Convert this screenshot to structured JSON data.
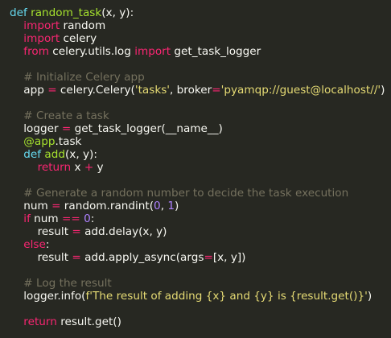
{
  "colors": {
    "background": "#272822",
    "plain": "#f8f8f2",
    "keyword": "#f92672",
    "def_keyword": "#66d9ef",
    "function_name": "#a6e22e",
    "string": "#e6db74",
    "number": "#ae81ff",
    "comment": "#75715e"
  },
  "code": {
    "lines": [
      [
        {
          "t": "def",
          "c": "def"
        },
        {
          "t": " ",
          "c": "plain"
        },
        {
          "t": "random_task",
          "c": "fn"
        },
        {
          "t": "(x, y):",
          "c": "plain"
        }
      ],
      [
        {
          "t": "    ",
          "c": "plain"
        },
        {
          "t": "import",
          "c": "kw"
        },
        {
          "t": " random",
          "c": "plain"
        }
      ],
      [
        {
          "t": "    ",
          "c": "plain"
        },
        {
          "t": "import",
          "c": "kw"
        },
        {
          "t": " celery",
          "c": "plain"
        }
      ],
      [
        {
          "t": "    ",
          "c": "plain"
        },
        {
          "t": "from",
          "c": "kw"
        },
        {
          "t": " celery.utils.log ",
          "c": "plain"
        },
        {
          "t": "import",
          "c": "kw"
        },
        {
          "t": " get_task_logger",
          "c": "plain"
        }
      ],
      [],
      [
        {
          "t": "    ",
          "c": "plain"
        },
        {
          "t": "# Initialize Celery app",
          "c": "cmt"
        }
      ],
      [
        {
          "t": "    app ",
          "c": "plain"
        },
        {
          "t": "=",
          "c": "op"
        },
        {
          "t": " celery.Celery(",
          "c": "plain"
        },
        {
          "t": "'tasks'",
          "c": "str"
        },
        {
          "t": ", broker",
          "c": "plain"
        },
        {
          "t": "=",
          "c": "op"
        },
        {
          "t": "'pyamqp://guest@localhost//'",
          "c": "str"
        },
        {
          "t": ")",
          "c": "plain"
        }
      ],
      [],
      [
        {
          "t": "    ",
          "c": "plain"
        },
        {
          "t": "# Create a task",
          "c": "cmt"
        }
      ],
      [
        {
          "t": "    logger ",
          "c": "plain"
        },
        {
          "t": "=",
          "c": "op"
        },
        {
          "t": " get_task_logger(__name__)",
          "c": "plain"
        }
      ],
      [
        {
          "t": "    ",
          "c": "plain"
        },
        {
          "t": "@app",
          "c": "dec"
        },
        {
          "t": ".task",
          "c": "plain"
        }
      ],
      [
        {
          "t": "    ",
          "c": "plain"
        },
        {
          "t": "def",
          "c": "def"
        },
        {
          "t": " ",
          "c": "plain"
        },
        {
          "t": "add",
          "c": "fn"
        },
        {
          "t": "(x, y):",
          "c": "plain"
        }
      ],
      [
        {
          "t": "        ",
          "c": "plain"
        },
        {
          "t": "return",
          "c": "kw"
        },
        {
          "t": " x ",
          "c": "plain"
        },
        {
          "t": "+",
          "c": "op"
        },
        {
          "t": " y",
          "c": "plain"
        }
      ],
      [],
      [
        {
          "t": "    ",
          "c": "plain"
        },
        {
          "t": "# Generate a random number to decide the task execution",
          "c": "cmt"
        }
      ],
      [
        {
          "t": "    num ",
          "c": "plain"
        },
        {
          "t": "=",
          "c": "op"
        },
        {
          "t": " random.randint(",
          "c": "plain"
        },
        {
          "t": "0",
          "c": "num"
        },
        {
          "t": ", ",
          "c": "plain"
        },
        {
          "t": "1",
          "c": "num"
        },
        {
          "t": ")",
          "c": "plain"
        }
      ],
      [
        {
          "t": "    ",
          "c": "plain"
        },
        {
          "t": "if",
          "c": "kw"
        },
        {
          "t": " num ",
          "c": "plain"
        },
        {
          "t": "==",
          "c": "op"
        },
        {
          "t": " ",
          "c": "plain"
        },
        {
          "t": "0",
          "c": "num"
        },
        {
          "t": ":",
          "c": "plain"
        }
      ],
      [
        {
          "t": "        result ",
          "c": "plain"
        },
        {
          "t": "=",
          "c": "op"
        },
        {
          "t": " add.delay(x, y)",
          "c": "plain"
        }
      ],
      [
        {
          "t": "    ",
          "c": "plain"
        },
        {
          "t": "else",
          "c": "kw"
        },
        {
          "t": ":",
          "c": "plain"
        }
      ],
      [
        {
          "t": "        result ",
          "c": "plain"
        },
        {
          "t": "=",
          "c": "op"
        },
        {
          "t": " add.apply_async(args",
          "c": "plain"
        },
        {
          "t": "=",
          "c": "op"
        },
        {
          "t": "[x, y])",
          "c": "plain"
        }
      ],
      [],
      [
        {
          "t": "    ",
          "c": "plain"
        },
        {
          "t": "# Log the result",
          "c": "cmt"
        }
      ],
      [
        {
          "t": "    logger.info(",
          "c": "plain"
        },
        {
          "t": "f'The result of adding {x} and {y} is {result.get()}'",
          "c": "str"
        },
        {
          "t": ")",
          "c": "plain"
        }
      ],
      [],
      [
        {
          "t": "    ",
          "c": "plain"
        },
        {
          "t": "return",
          "c": "kw"
        },
        {
          "t": " result.get()",
          "c": "plain"
        }
      ]
    ]
  }
}
